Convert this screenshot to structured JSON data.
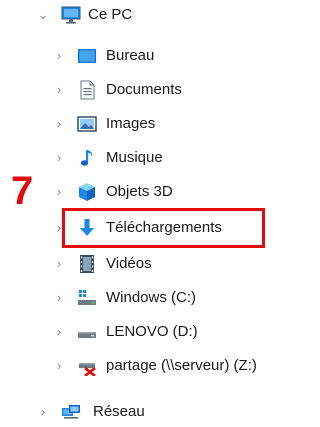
{
  "tree": {
    "root": {
      "label": "Ce PC",
      "icon": "monitor-icon",
      "expanded": true
    },
    "items": [
      {
        "label": "Bureau",
        "icon": "desktop-folder-icon"
      },
      {
        "label": "Documents",
        "icon": "documents-icon"
      },
      {
        "label": "Images",
        "icon": "pictures-icon"
      },
      {
        "label": "Musique",
        "icon": "music-icon"
      },
      {
        "label": "Objets 3D",
        "icon": "3d-objects-icon"
      },
      {
        "label": "Téléchargements",
        "icon": "downloads-icon"
      },
      {
        "label": "Vidéos",
        "icon": "videos-icon"
      },
      {
        "label": "Windows (C:)",
        "icon": "system-drive-icon"
      },
      {
        "label": "LENOVO (D:)",
        "icon": "drive-icon"
      },
      {
        "label": "partage (\\\\serveur) (Z:)",
        "icon": "disconnected-network-drive-icon"
      }
    ],
    "network": {
      "label": "Réseau",
      "icon": "network-icon"
    }
  },
  "annotation": {
    "step_number": "7",
    "color": "#e3080c"
  }
}
